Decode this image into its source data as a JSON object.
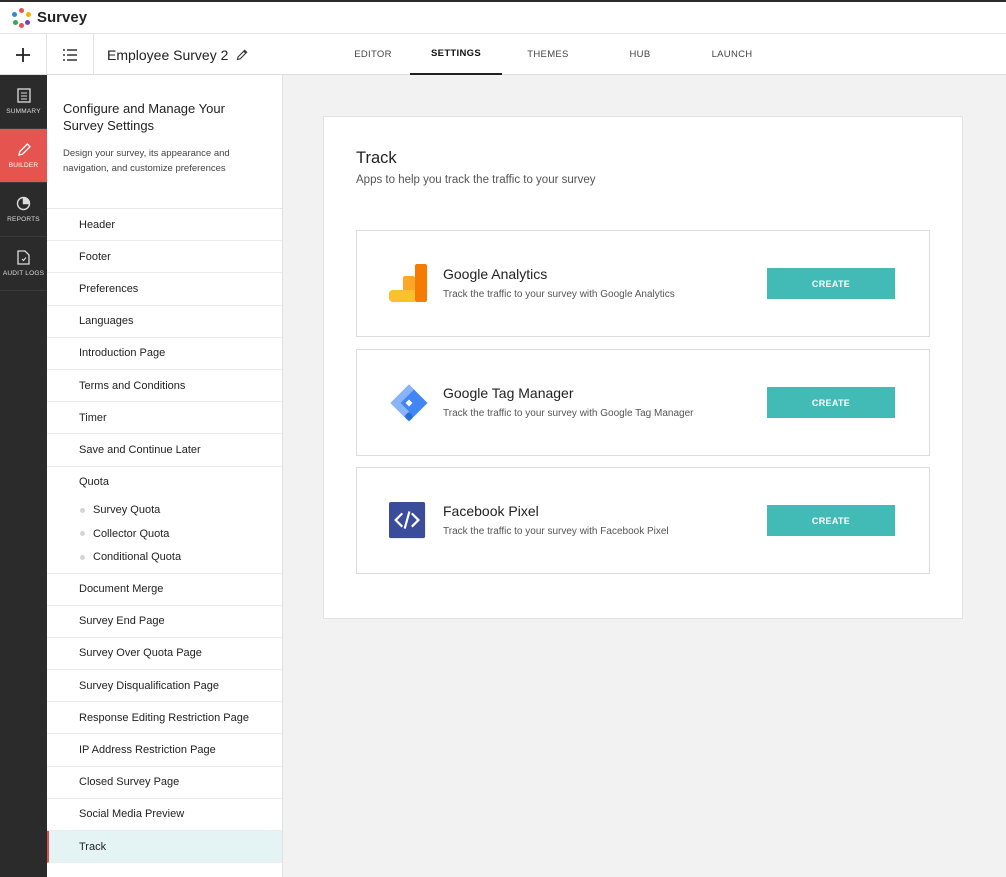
{
  "app": {
    "name": "Survey"
  },
  "header": {
    "survey_title": "Employee Survey 2",
    "tabs": [
      {
        "label": "EDITOR"
      },
      {
        "label": "SETTINGS"
      },
      {
        "label": "THEMES"
      },
      {
        "label": "HUB"
      },
      {
        "label": "LAUNCH"
      }
    ],
    "active_tab": "SETTINGS"
  },
  "rail": {
    "items": [
      {
        "label": "SUMMARY",
        "icon": "summary-icon"
      },
      {
        "label": "BUILDER",
        "icon": "pencil-icon"
      },
      {
        "label": "REPORTS",
        "icon": "pie-chart-icon"
      },
      {
        "label": "AUDIT LOGS",
        "icon": "document-icon"
      }
    ],
    "active": "BUILDER"
  },
  "sidebar": {
    "title": "Configure and Manage Your Survey Settings",
    "description": "Design your survey, its appearance and navigation, and customize preferences",
    "items": [
      {
        "label": "Header"
      },
      {
        "label": "Footer"
      },
      {
        "label": "Preferences"
      },
      {
        "label": "Languages"
      },
      {
        "label": "Introduction Page"
      },
      {
        "label": "Terms and Conditions"
      },
      {
        "label": "Timer"
      },
      {
        "label": "Save and Continue Later"
      }
    ],
    "quota": {
      "label": "Quota",
      "subitems": [
        {
          "label": "Survey Quota"
        },
        {
          "label": "Collector Quota"
        },
        {
          "label": "Conditional Quota"
        }
      ]
    },
    "items_after": [
      {
        "label": "Document Merge"
      },
      {
        "label": "Survey End Page"
      },
      {
        "label": "Survey Over Quota Page"
      },
      {
        "label": "Survey Disqualification Page"
      },
      {
        "label": "Response Editing Restriction Page"
      },
      {
        "label": "IP Address Restriction Page"
      },
      {
        "label": "Closed Survey Page"
      },
      {
        "label": "Social Media Preview"
      },
      {
        "label": "Track"
      }
    ],
    "active": "Track"
  },
  "main": {
    "title": "Track",
    "subtitle": "Apps to help you track the traffic to your survey",
    "apps": [
      {
        "name": "Google Analytics",
        "description": "Track the traffic to your survey with Google Analytics",
        "button": "CREATE",
        "icon": "google-analytics-icon"
      },
      {
        "name": "Google Tag Manager",
        "description": "Track the traffic to your survey with Google Tag Manager",
        "button": "CREATE",
        "icon": "google-tag-manager-icon"
      },
      {
        "name": "Facebook Pixel",
        "description": "Track the traffic to your survey with Facebook Pixel",
        "button": "CREATE",
        "icon": "code-icon"
      }
    ]
  },
  "colors": {
    "accent_teal": "#42bbb7",
    "builder_red": "#e5544f",
    "rail_dark": "#2b2b2b",
    "active_item_bg": "#e4f4f4"
  }
}
